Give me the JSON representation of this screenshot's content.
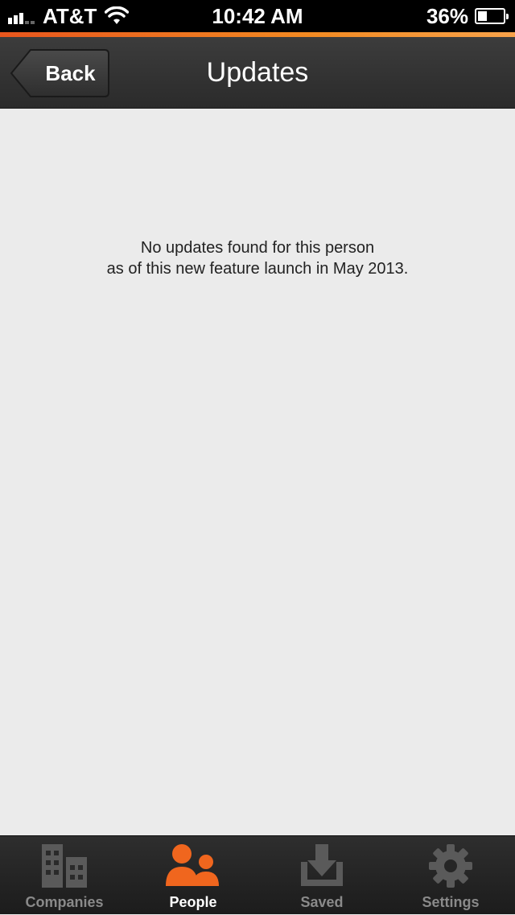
{
  "status_bar": {
    "carrier": "AT&T",
    "time": "10:42 AM",
    "battery": "36%",
    "battery_level": 0.36
  },
  "nav": {
    "back_label": "Back",
    "title": "Updates"
  },
  "content": {
    "message_line1": "No updates found for this person",
    "message_line2": "as of this new feature launch in May 2013."
  },
  "tabs": [
    {
      "label": "Companies",
      "icon": "buildings-icon",
      "active": false
    },
    {
      "label": "People",
      "icon": "people-icon",
      "active": true
    },
    {
      "label": "Saved",
      "icon": "download-tray-icon",
      "active": false
    },
    {
      "label": "Settings",
      "icon": "gear-icon",
      "active": false
    }
  ],
  "colors": {
    "accent": "#f0661e",
    "inactive_icon": "#5a5a5a"
  }
}
